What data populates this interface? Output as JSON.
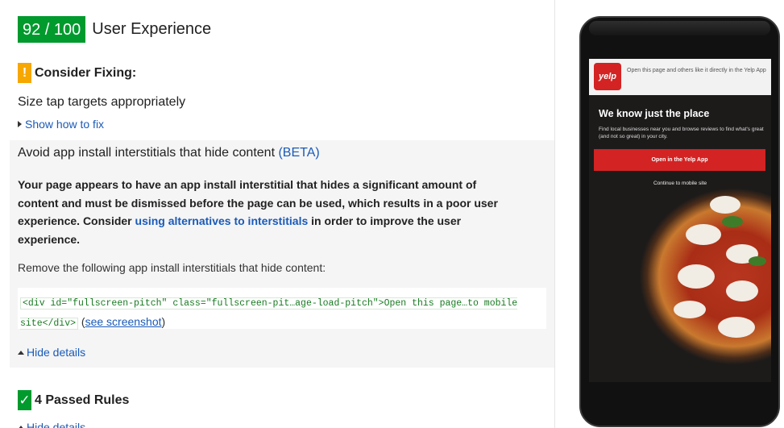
{
  "header": {
    "score": "92 / 100",
    "title": "User Experience"
  },
  "consider": {
    "icon": "!",
    "label": "Consider Fixing:"
  },
  "rule_tap": {
    "title": "Size tap targets appropriately",
    "toggle": "Show how to fix"
  },
  "rule_interstitial": {
    "title": "Avoid app install interstitials that hide content",
    "beta": "(BETA)",
    "desc_before": "Your page appears to have an app install interstitial that hides a significant amount of content and must be dismissed before the page can be used, which results in a poor user experience. Consider ",
    "desc_link": "using alternatives to interstitials",
    "desc_after": " in order to improve the user experience.",
    "remove_label": "Remove the following app install interstitials that hide content:",
    "code": "<div id=\"fullscreen-pitch\" class=\"fullscreen-pit…age-load-pitch\">Open this page…to mobile site</div>",
    "see_open": "(",
    "see_link": "see screenshot",
    "see_close": ")",
    "toggle": "Hide details"
  },
  "passed": {
    "icon": "✓",
    "label": "4 Passed Rules",
    "toggle": "Hide details"
  },
  "phone": {
    "logo": "yelp",
    "topbar_text": "Open this page and others like it directly in the Yelp App",
    "pitch_title": "We know just the place",
    "pitch_sub": "Find local businesses near you and browse reviews to find what's great (and not so great) in your city.",
    "open_button": "Open in the Yelp App",
    "continue_link": "Continue to mobile site"
  },
  "colors": {
    "score_green": "#009a2d",
    "warning_orange": "#f6a700",
    "link_blue": "#1a5ab8",
    "yelp_red": "#d32323"
  }
}
